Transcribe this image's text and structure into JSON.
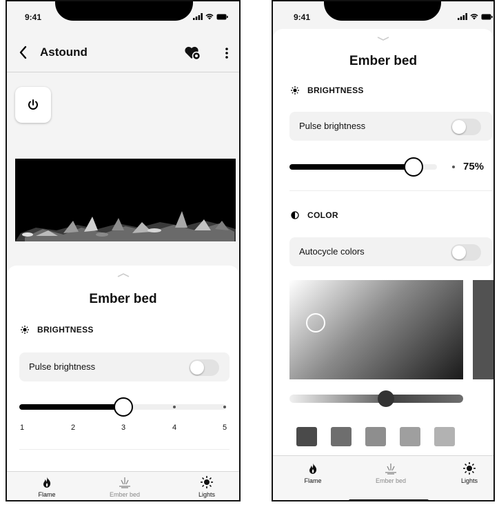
{
  "left_screen": {
    "status": {
      "time": "9:41"
    },
    "header": {
      "title": "Astound"
    },
    "sheet": {
      "title": "Ember bed",
      "brightness": {
        "heading": "BRIGHTNESS",
        "pulse_label": "Pulse brightness",
        "pulse_on": false,
        "steps": [
          "1",
          "2",
          "3",
          "4",
          "5"
        ],
        "value": 3
      }
    },
    "tabs": [
      {
        "label": "Flame",
        "active": true
      },
      {
        "label": "Ember bed",
        "active": false
      },
      {
        "label": "Lights",
        "active": true
      }
    ]
  },
  "right_screen": {
    "status": {
      "time": "9:41"
    },
    "sheet": {
      "title": "Ember bed",
      "brightness": {
        "heading": "BRIGHTNESS",
        "pulse_label": "Pulse brightness",
        "pulse_on": false,
        "percent_label": "75%",
        "percent_value": 0.75
      },
      "color": {
        "heading": "COLOR",
        "autocycle_label": "Autocycle colors",
        "autocycle_on": false,
        "preview_color": "#525252",
        "swatches": [
          "#4a4a4a",
          "#6e6e6e",
          "#8e8e8e",
          "#9f9f9f",
          "#b2b2b2"
        ]
      }
    },
    "tabs": [
      {
        "label": "Flame",
        "active": true
      },
      {
        "label": "Ember bed",
        "active": false
      },
      {
        "label": "Lights",
        "active": true
      }
    ]
  }
}
